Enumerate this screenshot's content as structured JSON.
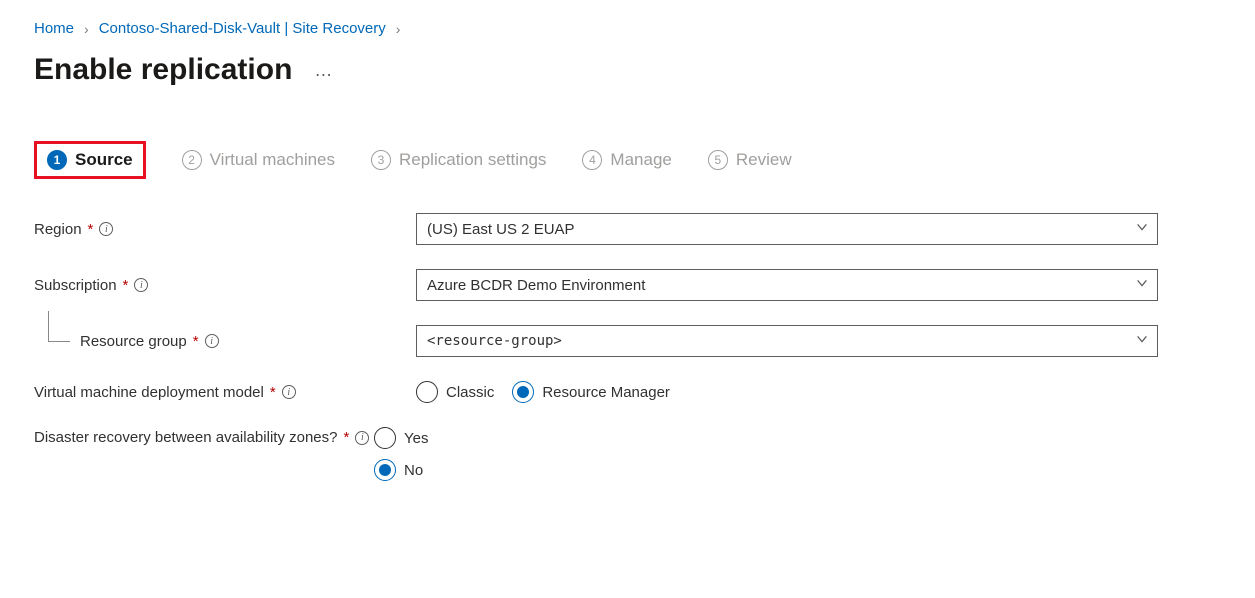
{
  "breadcrumb": {
    "home": "Home",
    "vault": "Contoso-Shared-Disk-Vault | Site Recovery"
  },
  "page_title": "Enable replication",
  "steps": [
    {
      "num": "1",
      "label": "Source",
      "active": true
    },
    {
      "num": "2",
      "label": "Virtual machines",
      "active": false
    },
    {
      "num": "3",
      "label": "Replication settings",
      "active": false
    },
    {
      "num": "4",
      "label": "Manage",
      "active": false
    },
    {
      "num": "5",
      "label": "Review",
      "active": false
    }
  ],
  "form": {
    "region": {
      "label": "Region",
      "value": "(US) East US 2 EUAP"
    },
    "subscription": {
      "label": "Subscription",
      "value": "Azure BCDR Demo Environment"
    },
    "resource_group": {
      "label": "Resource group",
      "value": "<resource-group>"
    },
    "vm_model": {
      "label": "Virtual machine deployment model",
      "options": {
        "classic": "Classic",
        "rm": "Resource Manager"
      },
      "selected": "rm"
    },
    "dr_zones": {
      "label": "Disaster recovery between availability zones?",
      "options": {
        "yes": "Yes",
        "no": "No"
      },
      "selected": "no"
    }
  }
}
